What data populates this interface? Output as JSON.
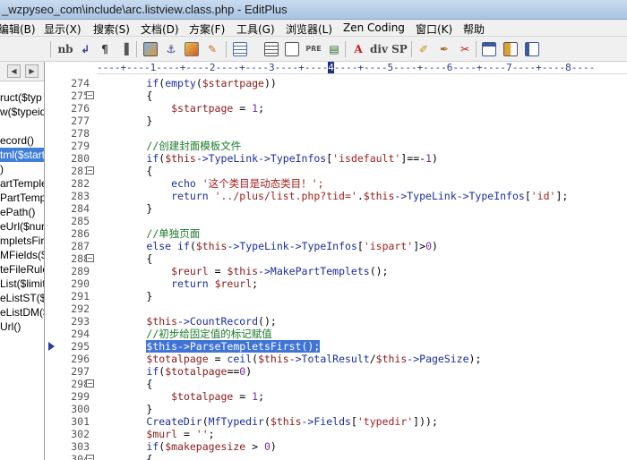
{
  "window": {
    "title": "_wzpyseo_com\\include\\arc.listview.class.php - EditPlus"
  },
  "menu": [
    "编辑(B)",
    "显示(X)",
    "搜索(S)",
    "文档(D)",
    "方案(F)",
    "工具(G)",
    "浏览器(L)",
    "Zen Coding",
    "窗口(K)",
    "帮助"
  ],
  "toolbar": {
    "icons": [
      "nb-text",
      "wrap-icon",
      "pilcrow-icon",
      "marker-icon",
      "image-icon",
      "anchor-icon",
      "color-icon",
      "edit-icon",
      "table-icon",
      "list-icon",
      "pre-text",
      "comment-icon",
      "text-a-icon",
      "div-text",
      "sp-text",
      "pen-icon",
      "brush-icon",
      "tools-icon",
      "window-icon",
      "cliptext-icon",
      "sidebar-icon"
    ],
    "labels": {
      "nb": "nb",
      "pre": "PRE",
      "div": "div",
      "sp": "SP"
    }
  },
  "sidebar": {
    "items": [
      {
        "label": "ruct($typ",
        "selected": false
      },
      {
        "label": "w($typeid",
        "selected": false
      },
      {
        "label": "",
        "selected": false
      },
      {
        "label": "ecord()",
        "selected": false
      },
      {
        "label": "tml($start",
        "selected": true
      },
      {
        "label": ")",
        "selected": false
      },
      {
        "label": "artTemple",
        "selected": false
      },
      {
        "label": "PartTemp",
        "selected": false
      },
      {
        "label": "ePath()",
        "selected": false
      },
      {
        "label": "eUrl($nurl",
        "selected": false
      },
      {
        "label": "mpletsFir",
        "selected": false
      },
      {
        "label": "MFields($",
        "selected": false
      },
      {
        "label": "teFileRule",
        "selected": false
      },
      {
        "label": "List($limit",
        "selected": false
      },
      {
        "label": "eListST($l",
        "selected": false
      },
      {
        "label": "eListDM($",
        "selected": false
      },
      {
        "label": "Url()",
        "selected": false
      }
    ]
  },
  "ruler": {
    "text": "----+----1----+----2----+----3----+----4----+----5----+----6----+----7----+----8----",
    "cursor_column": 39
  },
  "editor": {
    "lines": [
      {
        "n": "274",
        "fold": false,
        "tokens": [
          [
            "        ",
            ""
          ],
          [
            "if",
            "kw"
          ],
          [
            "(",
            "op"
          ],
          [
            "empty",
            "kw"
          ],
          [
            "(",
            "op"
          ],
          [
            "$startpage",
            "var"
          ],
          [
            "))",
            "op"
          ]
        ]
      },
      {
        "n": "275",
        "fold": true,
        "tokens": [
          [
            "        {",
            "op"
          ]
        ]
      },
      {
        "n": "276",
        "fold": false,
        "tokens": [
          [
            "            ",
            ""
          ],
          [
            "$startpage",
            "var"
          ],
          [
            " = ",
            "op"
          ],
          [
            "1",
            "cn"
          ],
          [
            ";",
            "op"
          ]
        ]
      },
      {
        "n": "277",
        "fold": false,
        "tokens": [
          [
            "        }",
            "op"
          ]
        ]
      },
      {
        "n": "278",
        "fold": false,
        "tokens": []
      },
      {
        "n": "279",
        "fold": false,
        "tokens": [
          [
            "        ",
            ""
          ],
          [
            "//创建封面模板文件",
            "cmt"
          ]
        ]
      },
      {
        "n": "280",
        "fold": false,
        "tokens": [
          [
            "        ",
            ""
          ],
          [
            "if",
            "kw"
          ],
          [
            "(",
            "op"
          ],
          [
            "$this",
            "var"
          ],
          [
            "->",
            "kw"
          ],
          [
            "TypeLink",
            "kw"
          ],
          [
            "->",
            "kw"
          ],
          [
            "TypeInfos",
            "kw"
          ],
          [
            "[",
            "op"
          ],
          [
            "'isdefault'",
            "str"
          ],
          [
            "]==-",
            "op"
          ],
          [
            "1",
            "cn"
          ],
          [
            ")",
            "op"
          ]
        ]
      },
      {
        "n": "281",
        "fold": true,
        "tokens": [
          [
            "        {",
            "op"
          ]
        ]
      },
      {
        "n": "282",
        "fold": false,
        "tokens": [
          [
            "            ",
            ""
          ],
          [
            "echo",
            "kw"
          ],
          [
            " ",
            ""
          ],
          [
            "'这个类目是动态类目！';",
            "str"
          ]
        ]
      },
      {
        "n": "283",
        "fold": false,
        "tokens": [
          [
            "            ",
            ""
          ],
          [
            "return",
            "kw"
          ],
          [
            " ",
            ""
          ],
          [
            "'../plus/list.php?tid='",
            "str"
          ],
          [
            ".",
            "op"
          ],
          [
            "$this",
            "var"
          ],
          [
            "->",
            "kw"
          ],
          [
            "TypeLink",
            "kw"
          ],
          [
            "->",
            "kw"
          ],
          [
            "TypeInfos",
            "kw"
          ],
          [
            "[",
            "op"
          ],
          [
            "'id'",
            "str"
          ],
          [
            "];",
            "op"
          ]
        ]
      },
      {
        "n": "284",
        "fold": false,
        "tokens": [
          [
            "        }",
            "op"
          ]
        ]
      },
      {
        "n": "285",
        "fold": false,
        "tokens": []
      },
      {
        "n": "286",
        "fold": false,
        "tokens": [
          [
            "        ",
            ""
          ],
          [
            "//单独页面",
            "cmt"
          ]
        ]
      },
      {
        "n": "287",
        "fold": false,
        "tokens": [
          [
            "        ",
            ""
          ],
          [
            "else",
            "kw"
          ],
          [
            " ",
            ""
          ],
          [
            "if",
            "kw"
          ],
          [
            "(",
            "op"
          ],
          [
            "$this",
            "var"
          ],
          [
            "->",
            "kw"
          ],
          [
            "TypeLink",
            "kw"
          ],
          [
            "->",
            "kw"
          ],
          [
            "TypeInfos",
            "kw"
          ],
          [
            "[",
            "op"
          ],
          [
            "'ispart'",
            "str"
          ],
          [
            "]>",
            "op"
          ],
          [
            "0",
            "cn"
          ],
          [
            ")",
            "op"
          ]
        ]
      },
      {
        "n": "288",
        "fold": true,
        "tokens": [
          [
            "        {",
            "op"
          ]
        ]
      },
      {
        "n": "289",
        "fold": false,
        "tokens": [
          [
            "            ",
            ""
          ],
          [
            "$reurl",
            "var"
          ],
          [
            " = ",
            "op"
          ],
          [
            "$this",
            "var"
          ],
          [
            "->",
            "kw"
          ],
          [
            "MakePartTemplets",
            "kw"
          ],
          [
            "();",
            "op"
          ]
        ]
      },
      {
        "n": "290",
        "fold": false,
        "tokens": [
          [
            "            ",
            ""
          ],
          [
            "return",
            "kw"
          ],
          [
            " ",
            ""
          ],
          [
            "$reurl",
            "var"
          ],
          [
            ";",
            "op"
          ]
        ]
      },
      {
        "n": "291",
        "fold": false,
        "tokens": [
          [
            "        }",
            "op"
          ]
        ]
      },
      {
        "n": "292",
        "fold": false,
        "tokens": []
      },
      {
        "n": "293",
        "fold": false,
        "tokens": [
          [
            "        ",
            ""
          ],
          [
            "$this",
            "var"
          ],
          [
            "->",
            "kw"
          ],
          [
            "CountRecord",
            "kw"
          ],
          [
            "();",
            "op"
          ]
        ]
      },
      {
        "n": "294",
        "fold": false,
        "tokens": [
          [
            "        ",
            ""
          ],
          [
            "//初步给固定值的标记赋值",
            "cmt"
          ]
        ]
      },
      {
        "n": "295",
        "fold": false,
        "bookmark": true,
        "tokens": [
          [
            "        ",
            ""
          ],
          [
            "$this->ParseTempletsFirst();",
            "hl"
          ]
        ]
      },
      {
        "n": "296",
        "fold": false,
        "tokens": [
          [
            "        ",
            ""
          ],
          [
            "$totalpage",
            "var"
          ],
          [
            " = ",
            "op"
          ],
          [
            "ceil",
            "kw"
          ],
          [
            "(",
            "op"
          ],
          [
            "$this",
            "var"
          ],
          [
            "->",
            "kw"
          ],
          [
            "TotalResult",
            "kw"
          ],
          [
            "/",
            "op"
          ],
          [
            "$this",
            "var"
          ],
          [
            "->",
            "kw"
          ],
          [
            "PageSize",
            "kw"
          ],
          [
            ");",
            "op"
          ]
        ]
      },
      {
        "n": "297",
        "fold": false,
        "tokens": [
          [
            "        ",
            ""
          ],
          [
            "if",
            "kw"
          ],
          [
            "(",
            "op"
          ],
          [
            "$totalpage",
            "var"
          ],
          [
            "==",
            "op"
          ],
          [
            "0",
            "cn"
          ],
          [
            ")",
            "op"
          ]
        ]
      },
      {
        "n": "298",
        "fold": true,
        "tokens": [
          [
            "        {",
            "op"
          ]
        ]
      },
      {
        "n": "299",
        "fold": false,
        "tokens": [
          [
            "            ",
            ""
          ],
          [
            "$totalpage",
            "var"
          ],
          [
            " = ",
            "op"
          ],
          [
            "1",
            "cn"
          ],
          [
            ";",
            "op"
          ]
        ]
      },
      {
        "n": "300",
        "fold": false,
        "tokens": [
          [
            "        }",
            "op"
          ]
        ]
      },
      {
        "n": "301",
        "fold": false,
        "tokens": [
          [
            "        ",
            ""
          ],
          [
            "CreateDir",
            "kw"
          ],
          [
            "(",
            "op"
          ],
          [
            "MfTypedir",
            "kw"
          ],
          [
            "(",
            "op"
          ],
          [
            "$this",
            "var"
          ],
          [
            "->",
            "kw"
          ],
          [
            "Fields",
            "kw"
          ],
          [
            "[",
            "op"
          ],
          [
            "'typedir'",
            "str"
          ],
          [
            "]));",
            "op"
          ]
        ]
      },
      {
        "n": "302",
        "fold": false,
        "tokens": [
          [
            "        ",
            ""
          ],
          [
            "$murl",
            "var"
          ],
          [
            " = ",
            "op"
          ],
          [
            "''",
            "str"
          ],
          [
            ";",
            "op"
          ]
        ]
      },
      {
        "n": "303",
        "fold": false,
        "tokens": [
          [
            "        ",
            ""
          ],
          [
            "if",
            "kw"
          ],
          [
            "(",
            "op"
          ],
          [
            "$makepagesize",
            "var"
          ],
          [
            " > ",
            "op"
          ],
          [
            "0",
            "cn"
          ],
          [
            ")",
            "op"
          ]
        ]
      },
      {
        "n": "304",
        "fold": true,
        "tokens": [
          [
            "        {",
            "op"
          ]
        ]
      }
    ]
  },
  "colors": {
    "keyword": "#1b2d9c",
    "variable": "#8b1a1a",
    "string": "#a02020",
    "comment": "#1b7a2a",
    "selection": "#3f74d6"
  }
}
